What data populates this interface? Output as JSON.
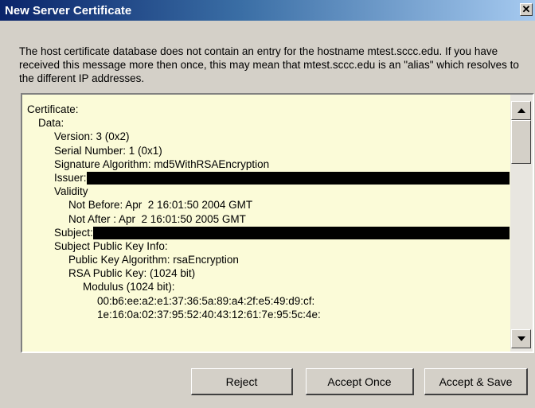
{
  "window": {
    "title": "New Server Certificate",
    "close_glyph": "✕"
  },
  "message": "The host certificate database does not contain an entry for the hostname mtest.sccc.edu. If you have received this message more then once, this may mean that mtest.sccc.edu is an \"alias\" which resolves to the different IP addresses.",
  "certificate": {
    "lines": [
      {
        "indent": 0,
        "text": "Certificate:"
      },
      {
        "indent": 1,
        "text": "Data:"
      },
      {
        "indent": 2,
        "text": "Version: 3 (0x2)"
      },
      {
        "indent": 2,
        "text": "Serial Number: 1 (0x1)"
      },
      {
        "indent": 2,
        "text": "Signature Algorithm: md5WithRSAEncryption"
      },
      {
        "indent": 2,
        "text": "Issuer:",
        "redacted": true
      },
      {
        "indent": 2,
        "text": "Validity"
      },
      {
        "indent": 3,
        "text": "Not Before: Apr  2 16:01:50 2004 GMT"
      },
      {
        "indent": 3,
        "text": "Not After : Apr  2 16:01:50 2005 GMT"
      },
      {
        "indent": 2,
        "text": "Subject:",
        "redacted": true
      },
      {
        "indent": 2,
        "text": "Subject Public Key Info:"
      },
      {
        "indent": 3,
        "text": "Public Key Algorithm: rsaEncryption"
      },
      {
        "indent": 3,
        "text": "RSA Public Key: (1024 bit)"
      },
      {
        "indent": 4,
        "text": "Modulus (1024 bit):"
      },
      {
        "indent": 5,
        "text": "00:b6:ee:a2:e1:37:36:5a:89:a4:2f:e5:49:d9:cf:"
      },
      {
        "indent": 5,
        "text": "1e:16:0a:02:37:95:52:40:43:12:61:7e:95:5c:4e:"
      }
    ]
  },
  "buttons": {
    "reject": "Reject",
    "accept_once": "Accept Once",
    "accept_save": "Accept & Save"
  },
  "icons": {
    "close": "close-icon",
    "scroll_up": "arrow-up-icon",
    "scroll_down": "arrow-down-icon"
  }
}
